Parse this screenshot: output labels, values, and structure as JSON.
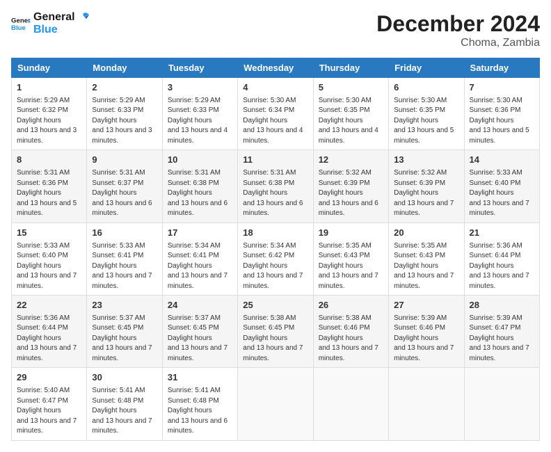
{
  "logo": {
    "line1": "General",
    "line2": "Blue"
  },
  "title": "December 2024",
  "location": "Choma, Zambia",
  "headers": [
    "Sunday",
    "Monday",
    "Tuesday",
    "Wednesday",
    "Thursday",
    "Friday",
    "Saturday"
  ],
  "weeks": [
    [
      {
        "day": 1,
        "sunrise": "5:29 AM",
        "sunset": "6:32 PM",
        "daylight": "13 hours and 3 minutes."
      },
      {
        "day": 2,
        "sunrise": "5:29 AM",
        "sunset": "6:33 PM",
        "daylight": "13 hours and 3 minutes."
      },
      {
        "day": 3,
        "sunrise": "5:29 AM",
        "sunset": "6:33 PM",
        "daylight": "13 hours and 4 minutes."
      },
      {
        "day": 4,
        "sunrise": "5:30 AM",
        "sunset": "6:34 PM",
        "daylight": "13 hours and 4 minutes."
      },
      {
        "day": 5,
        "sunrise": "5:30 AM",
        "sunset": "6:35 PM",
        "daylight": "13 hours and 4 minutes."
      },
      {
        "day": 6,
        "sunrise": "5:30 AM",
        "sunset": "6:35 PM",
        "daylight": "13 hours and 5 minutes."
      },
      {
        "day": 7,
        "sunrise": "5:30 AM",
        "sunset": "6:36 PM",
        "daylight": "13 hours and 5 minutes."
      }
    ],
    [
      {
        "day": 8,
        "sunrise": "5:31 AM",
        "sunset": "6:36 PM",
        "daylight": "13 hours and 5 minutes."
      },
      {
        "day": 9,
        "sunrise": "5:31 AM",
        "sunset": "6:37 PM",
        "daylight": "13 hours and 6 minutes."
      },
      {
        "day": 10,
        "sunrise": "5:31 AM",
        "sunset": "6:38 PM",
        "daylight": "13 hours and 6 minutes."
      },
      {
        "day": 11,
        "sunrise": "5:31 AM",
        "sunset": "6:38 PM",
        "daylight": "13 hours and 6 minutes."
      },
      {
        "day": 12,
        "sunrise": "5:32 AM",
        "sunset": "6:39 PM",
        "daylight": "13 hours and 6 minutes."
      },
      {
        "day": 13,
        "sunrise": "5:32 AM",
        "sunset": "6:39 PM",
        "daylight": "13 hours and 7 minutes."
      },
      {
        "day": 14,
        "sunrise": "5:33 AM",
        "sunset": "6:40 PM",
        "daylight": "13 hours and 7 minutes."
      }
    ],
    [
      {
        "day": 15,
        "sunrise": "5:33 AM",
        "sunset": "6:40 PM",
        "daylight": "13 hours and 7 minutes."
      },
      {
        "day": 16,
        "sunrise": "5:33 AM",
        "sunset": "6:41 PM",
        "daylight": "13 hours and 7 minutes."
      },
      {
        "day": 17,
        "sunrise": "5:34 AM",
        "sunset": "6:41 PM",
        "daylight": "13 hours and 7 minutes."
      },
      {
        "day": 18,
        "sunrise": "5:34 AM",
        "sunset": "6:42 PM",
        "daylight": "13 hours and 7 minutes."
      },
      {
        "day": 19,
        "sunrise": "5:35 AM",
        "sunset": "6:43 PM",
        "daylight": "13 hours and 7 minutes."
      },
      {
        "day": 20,
        "sunrise": "5:35 AM",
        "sunset": "6:43 PM",
        "daylight": "13 hours and 7 minutes."
      },
      {
        "day": 21,
        "sunrise": "5:36 AM",
        "sunset": "6:44 PM",
        "daylight": "13 hours and 7 minutes."
      }
    ],
    [
      {
        "day": 22,
        "sunrise": "5:36 AM",
        "sunset": "6:44 PM",
        "daylight": "13 hours and 7 minutes."
      },
      {
        "day": 23,
        "sunrise": "5:37 AM",
        "sunset": "6:45 PM",
        "daylight": "13 hours and 7 minutes."
      },
      {
        "day": 24,
        "sunrise": "5:37 AM",
        "sunset": "6:45 PM",
        "daylight": "13 hours and 7 minutes."
      },
      {
        "day": 25,
        "sunrise": "5:38 AM",
        "sunset": "6:45 PM",
        "daylight": "13 hours and 7 minutes."
      },
      {
        "day": 26,
        "sunrise": "5:38 AM",
        "sunset": "6:46 PM",
        "daylight": "13 hours and 7 minutes."
      },
      {
        "day": 27,
        "sunrise": "5:39 AM",
        "sunset": "6:46 PM",
        "daylight": "13 hours and 7 minutes."
      },
      {
        "day": 28,
        "sunrise": "5:39 AM",
        "sunset": "6:47 PM",
        "daylight": "13 hours and 7 minutes."
      }
    ],
    [
      {
        "day": 29,
        "sunrise": "5:40 AM",
        "sunset": "6:47 PM",
        "daylight": "13 hours and 7 minutes."
      },
      {
        "day": 30,
        "sunrise": "5:41 AM",
        "sunset": "6:48 PM",
        "daylight": "13 hours and 7 minutes."
      },
      {
        "day": 31,
        "sunrise": "5:41 AM",
        "sunset": "6:48 PM",
        "daylight": "13 hours and 6 minutes."
      },
      null,
      null,
      null,
      null
    ]
  ]
}
